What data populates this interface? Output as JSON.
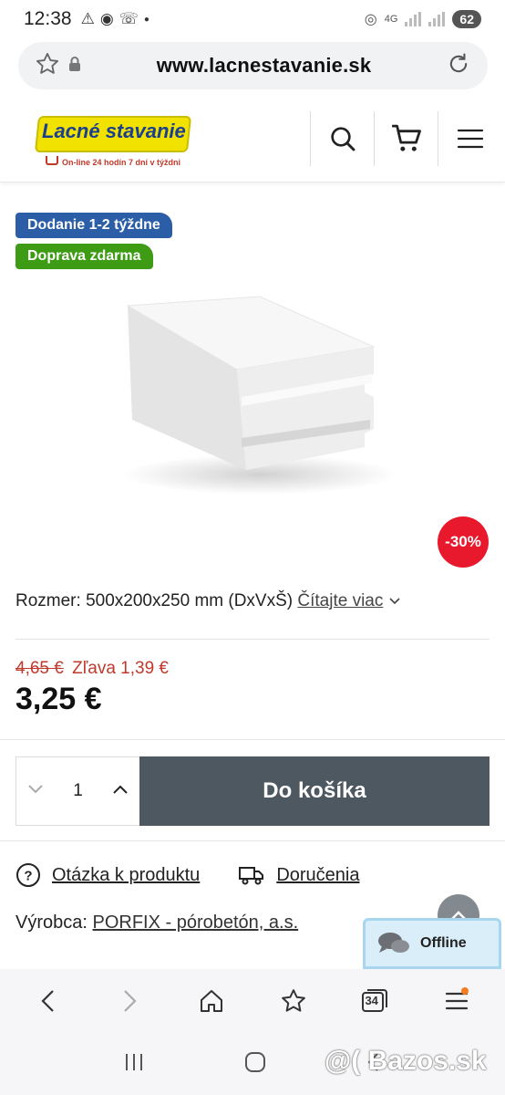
{
  "status_bar": {
    "time": "12:38",
    "network": "4G",
    "battery": "62"
  },
  "browser": {
    "url": "www.lacnestavanie.sk"
  },
  "site": {
    "logo_name": "Lacné stavanie",
    "logo_tagline": "On-line 24 hodín 7 dní v týždni"
  },
  "labels": {
    "delivery": "Dodanie 1-2 týždne",
    "shipping": "Doprava zdarma"
  },
  "product": {
    "discount_badge": "-30%",
    "size_text": "Rozmer: 500x200x250 mm (DxVxŠ)",
    "read_more": "Čítajte viac",
    "old_price": "4,65 €",
    "discount_text": "Zľava 1,39 €",
    "price": "3,25 €",
    "quantity": "1"
  },
  "buy": {
    "add_to_cart": "Do košíka"
  },
  "links": {
    "question": "Otázka k produktu",
    "delivery": "Doručenia"
  },
  "maker": {
    "label": "Výrobca:",
    "value": "PORFIX - pórobetón, a.s."
  },
  "chat": {
    "status": "Offline"
  },
  "bottom_nav": {
    "tabs_count": "34"
  },
  "watermark": "@( Bazos.sk",
  "colors": {
    "blue_label": "#2c5ea8",
    "green_label": "#3d9b14",
    "discount": "#e8192c",
    "button": "#4e5861",
    "old_price": "#c0392b"
  }
}
